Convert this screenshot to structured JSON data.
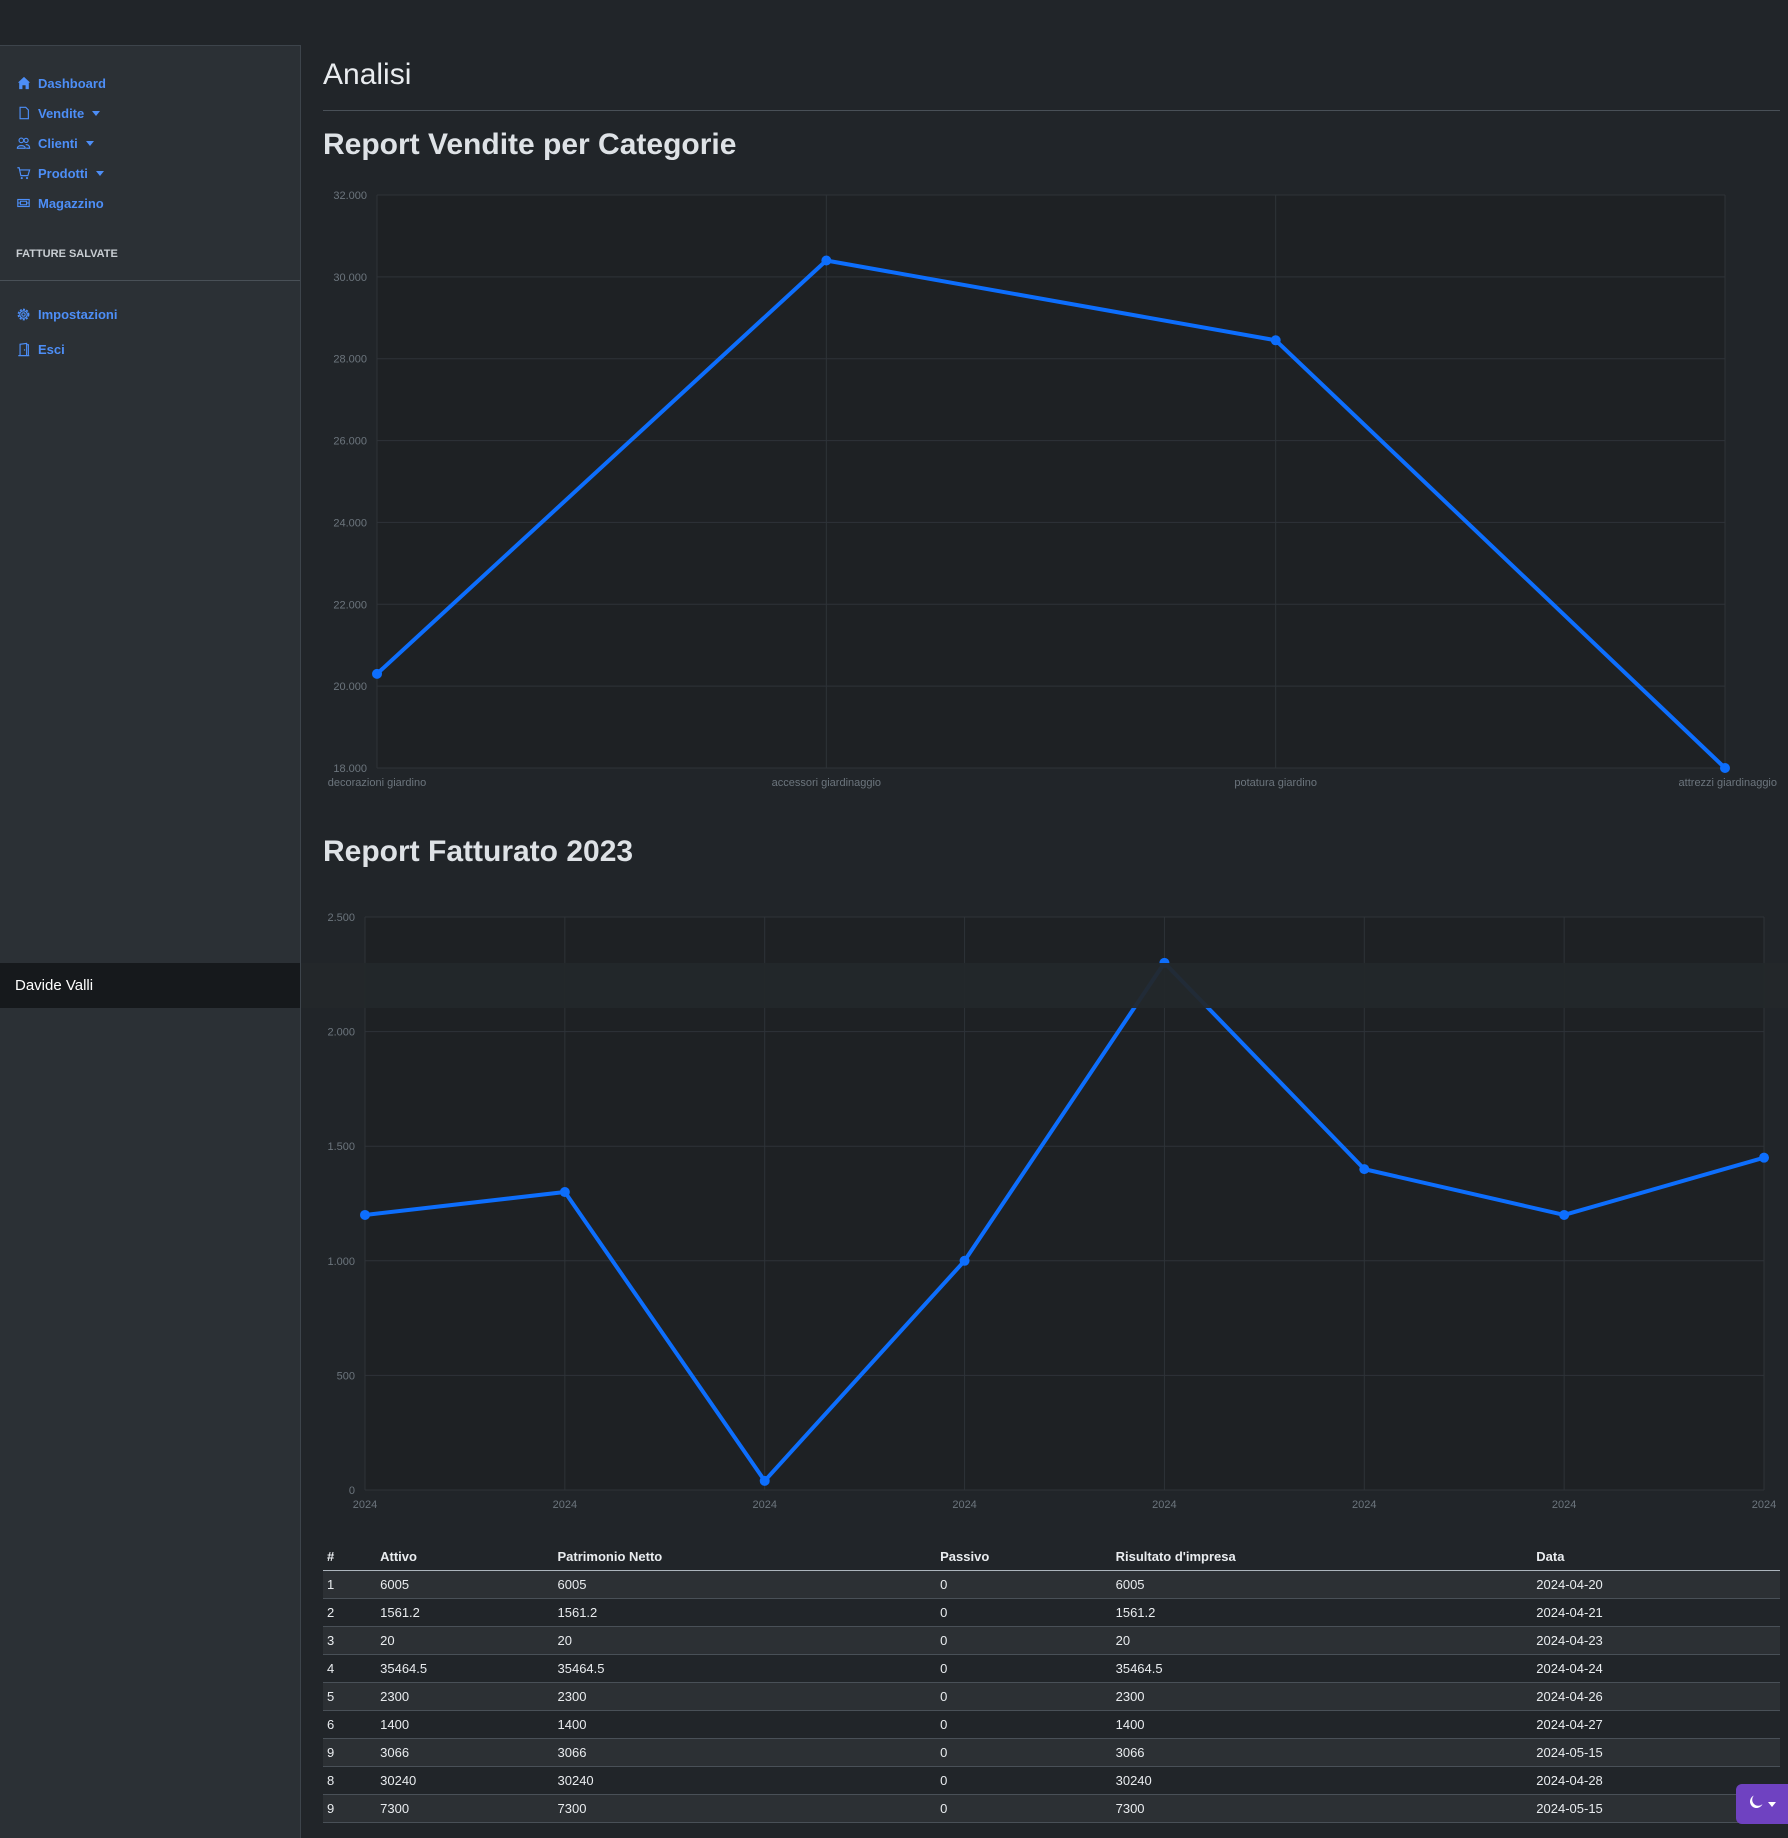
{
  "sidebar": {
    "items": [
      {
        "label": "Dashboard",
        "icon": "house-icon"
      },
      {
        "label": "Vendite",
        "icon": "file-icon",
        "dropdown": true
      },
      {
        "label": "Clienti",
        "icon": "people-icon",
        "dropdown": true
      },
      {
        "label": "Prodotti",
        "icon": "cart-icon",
        "dropdown": true
      },
      {
        "label": "Magazzino",
        "icon": "boxes-icon"
      }
    ],
    "section_heading": "FATTURE SALVATE",
    "bottom_items": [
      {
        "label": "Impostazioni",
        "icon": "gear-icon"
      },
      {
        "label": "Esci",
        "icon": "door-icon"
      }
    ],
    "user_name": "Davide Valli"
  },
  "main": {
    "title": "Analisi",
    "chart1_title": "Report Vendite per Categorie",
    "chart2_title": "Report Fatturato 2023"
  },
  "chart_data": [
    {
      "type": "line",
      "title": "Report Vendite per Categorie",
      "categories": [
        "decorazioni giardino",
        "accessori giardinaggio",
        "potatura giardino",
        "attrezzi giardinaggio"
      ],
      "values": [
        20300,
        30400,
        28450,
        18000
      ],
      "ylim": [
        18000,
        32000
      ],
      "yticks": [
        "18.000",
        "20.000",
        "22.000",
        "24.000",
        "26.000",
        "28.000",
        "30.000",
        "32.000"
      ],
      "grid": true,
      "color": "#0d6efd"
    },
    {
      "type": "line",
      "title": "Report Fatturato 2023",
      "categories": [
        "2024",
        "2024",
        "2024",
        "2024",
        "2024",
        "2024",
        "2024",
        "2024"
      ],
      "values": [
        1200,
        1300,
        40,
        1000,
        2300,
        1400,
        1200,
        1450
      ],
      "ylim": [
        0,
        2500
      ],
      "yticks": [
        "0",
        "500",
        "1.000",
        "1.500",
        "2.000",
        "2.500"
      ],
      "grid": true,
      "color": "#0d6efd"
    }
  ],
  "table": {
    "headers": [
      "#",
      "Attivo",
      "Patrimonio Netto",
      "Passivo",
      "Risultato d'impresa",
      "Data"
    ],
    "rows": [
      [
        "1",
        "6005",
        "6005",
        "0",
        "6005",
        "2024-04-20"
      ],
      [
        "2",
        "1561.2",
        "1561.2",
        "0",
        "1561.2",
        "2024-04-21"
      ],
      [
        "3",
        "20",
        "20",
        "0",
        "20",
        "2024-04-23"
      ],
      [
        "4",
        "35464.5",
        "35464.5",
        "0",
        "35464.5",
        "2024-04-24"
      ],
      [
        "5",
        "2300",
        "2300",
        "0",
        "2300",
        "2024-04-26"
      ],
      [
        "6",
        "1400",
        "1400",
        "0",
        "1400",
        "2024-04-27"
      ],
      [
        "9",
        "3066",
        "3066",
        "0",
        "3066",
        "2024-05-15"
      ],
      [
        "8",
        "30240",
        "30240",
        "0",
        "30240",
        "2024-04-28"
      ],
      [
        "9",
        "7300",
        "7300",
        "0",
        "7300",
        "2024-05-15"
      ]
    ]
  },
  "theme_toggle": {
    "icon": "moon-icon"
  },
  "colors": {
    "accent": "#0d6efd",
    "link": "#4d8ef7",
    "toggle": "#6f42c1"
  }
}
